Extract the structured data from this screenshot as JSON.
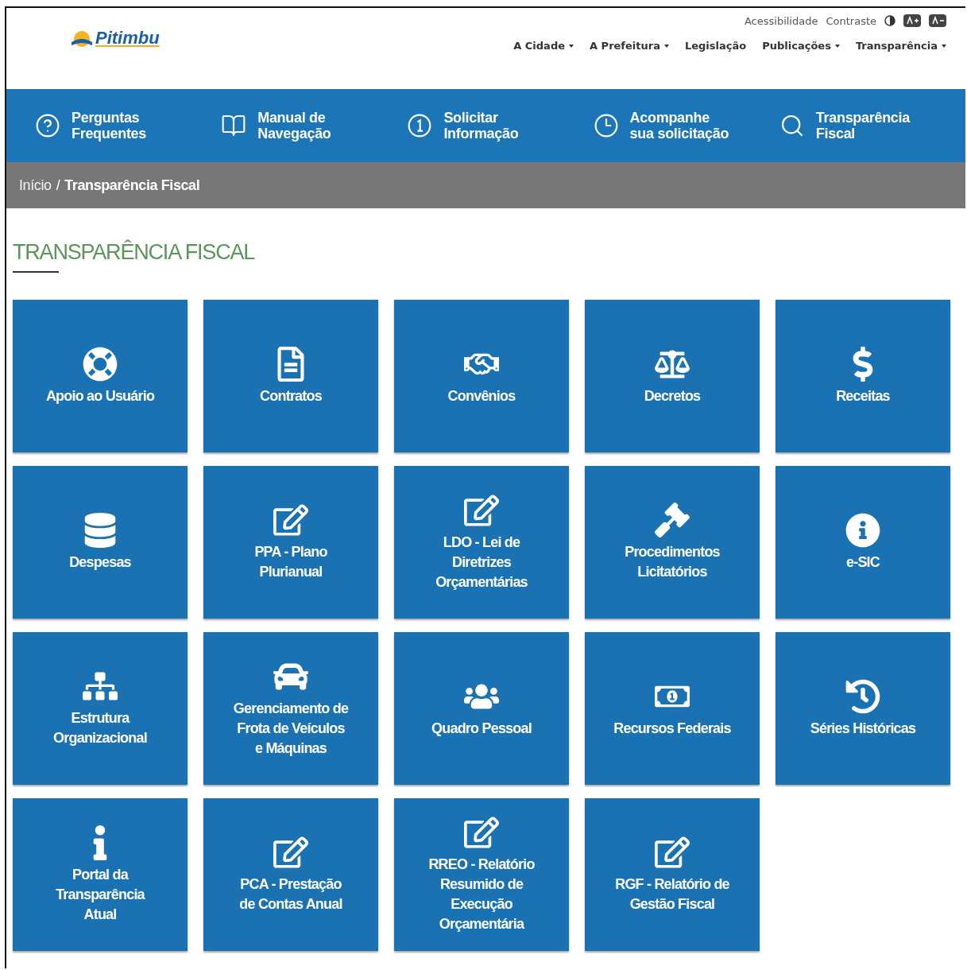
{
  "header": {
    "logo": "Pitimbu",
    "utility_links": [
      "Acessibilidade",
      "Contraste"
    ],
    "menu": [
      {
        "label": "A Cidade",
        "has_menu": true
      },
      {
        "label": "A Prefeitura",
        "has_menu": true
      },
      {
        "label": "Legislação",
        "has_menu": false
      },
      {
        "label": "Publicações",
        "has_menu": true
      },
      {
        "label": "Transparência",
        "has_menu": true
      }
    ]
  },
  "quick_links": [
    {
      "label": "Perguntas\nFrequentes"
    },
    {
      "label": "Manual de\nNavegação"
    },
    {
      "label": "Solicitar\nInformação"
    },
    {
      "label": "Acompanhe\nsua solicitação"
    },
    {
      "label": "Transparência\nFiscal"
    }
  ],
  "breadcrumb": {
    "items": [
      "Início",
      "Transparência Fiscal"
    ],
    "separator": "/"
  },
  "page_title": "TRANSPARÊNCIA FISCAL",
  "tiles": [
    {
      "label": "Apoio ao Usuário"
    },
    {
      "label": "Contratos"
    },
    {
      "label": "Convênios"
    },
    {
      "label": "Decretos"
    },
    {
      "label": "Receitas"
    },
    {
      "label": "Despesas"
    },
    {
      "label": "PPA - Plano\nPlurianual"
    },
    {
      "label": "LDO - Lei de\nDiretrizes\nOrçamentárias"
    },
    {
      "label": "Procedimentos\nLicitatórios"
    },
    {
      "label": "e-SIC"
    },
    {
      "label": "Estrutura\nOrganizacional"
    },
    {
      "label": "Gerenciamento de\nFrota de Veículos\ne Máquinas"
    },
    {
      "label": "Quadro Pessoal"
    },
    {
      "label": "Recursos Federais"
    },
    {
      "label": "Séries Históricas"
    },
    {
      "label": "Portal da\nTransparência\nAtual"
    },
    {
      "label": "PCA - Prestação\nde Contas Anual"
    },
    {
      "label": "RREO - Relatório\nResumido de\nExecução\nOrçamentária"
    },
    {
      "label": "RGF - Relatório de\nGestão Fiscal"
    }
  ]
}
